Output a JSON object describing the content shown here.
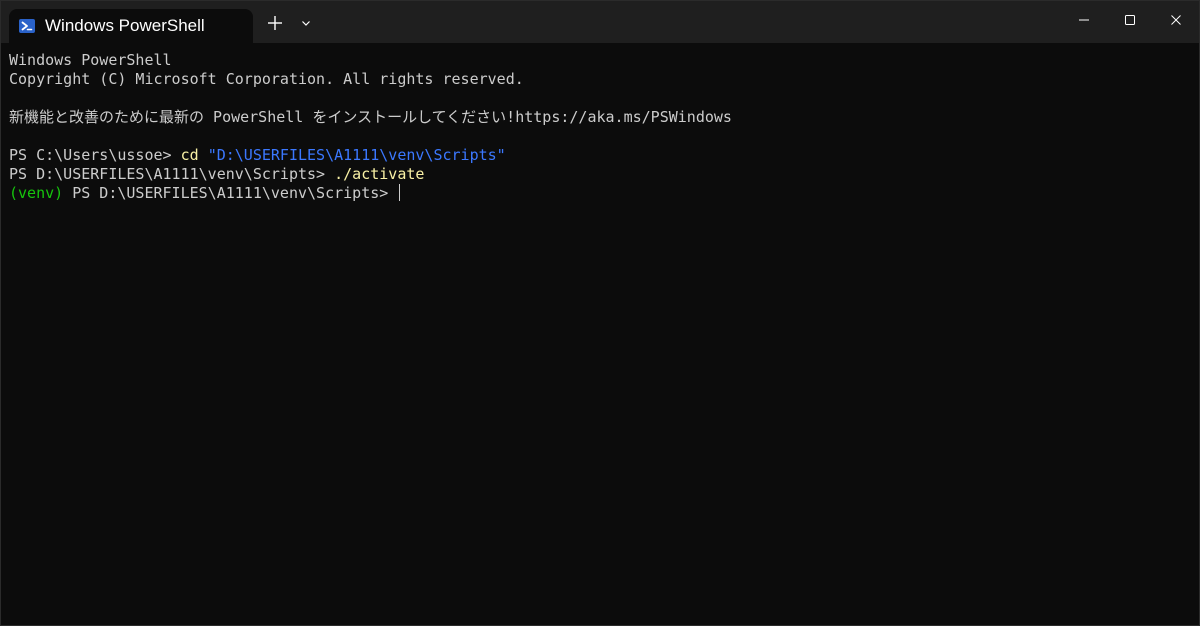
{
  "window": {
    "tab_title": "Windows PowerShell",
    "tab_icon": "powershell-icon",
    "new_tab_icon": "plus-icon",
    "dropdown_icon": "chevron-down-icon",
    "minimize_icon": "minimize-icon",
    "maximize_icon": "maximize-icon",
    "close_icon": "close-icon"
  },
  "colors": {
    "background": "#0c0c0c",
    "titlebar": "#1f1f1f",
    "text": "#cccccc",
    "command": "#f9f1a5",
    "string": "#3b78ff",
    "venv": "#16c60c"
  },
  "terminal": {
    "header_line1": "Windows PowerShell",
    "header_line2": "Copyright (C) Microsoft Corporation. All rights reserved.",
    "notice_line": "新機能と改善のために最新の PowerShell をインストールしてください!https://aka.ms/PSWindows",
    "cmd1": {
      "prompt": "PS C:\\Users\\ussoe> ",
      "command": "cd",
      "argument": "\"D:\\USERFILES\\A1111\\venv\\Scripts\""
    },
    "cmd2": {
      "prompt": "PS D:\\USERFILES\\A1111\\venv\\Scripts> ",
      "command": "./activate"
    },
    "cmd3": {
      "venv": "(venv)",
      "prompt": " PS D:\\USERFILES\\A1111\\venv\\Scripts> "
    }
  }
}
